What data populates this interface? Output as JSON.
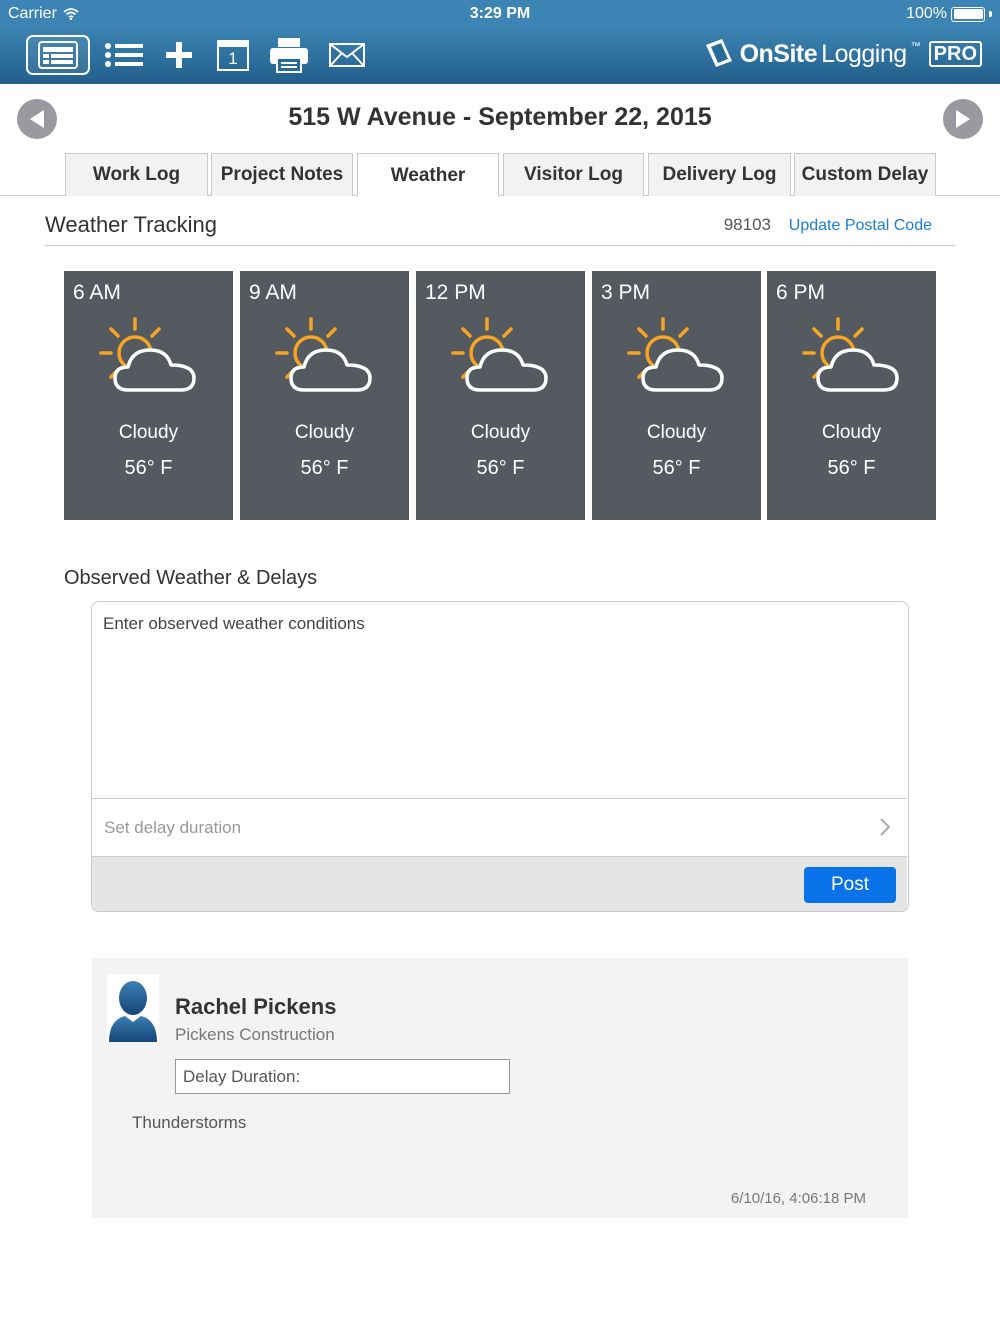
{
  "status": {
    "carrier": "Carrier",
    "time": "3:29 PM",
    "battery": "100%"
  },
  "toolbar": {
    "logo_onsite": "OnSite",
    "logo_logging": "Logging",
    "logo_tm": "™",
    "logo_pro": "PRO",
    "icons": [
      "daily-log-icon",
      "list-icon",
      "plus-icon",
      "calendar-icon",
      "printer-icon",
      "mail-icon"
    ],
    "calendar_day": "1"
  },
  "header": {
    "title": "515 W Avenue - September 22, 2015"
  },
  "tabs": [
    {
      "label": "Work Log"
    },
    {
      "label": "Project Notes"
    },
    {
      "label": "Weather"
    },
    {
      "label": "Visitor Log"
    },
    {
      "label": "Delivery Log"
    },
    {
      "label": "Custom Delay"
    }
  ],
  "active_tab": "Weather",
  "weather": {
    "title": "Weather Tracking",
    "postal_code": "98103",
    "update_link": "Update Postal Code",
    "forecast": [
      {
        "time": "6 AM",
        "condition": "Cloudy",
        "temp": "56° F"
      },
      {
        "time": "9 AM",
        "condition": "Cloudy",
        "temp": "56° F"
      },
      {
        "time": "12 PM",
        "condition": "Cloudy",
        "temp": "56° F"
      },
      {
        "time": "3 PM",
        "condition": "Cloudy",
        "temp": "56° F"
      },
      {
        "time": "6 PM",
        "condition": "Cloudy",
        "temp": "56° F"
      }
    ]
  },
  "observed": {
    "title": "Observed Weather & Delays",
    "placeholder": "Enter observed weather conditions",
    "value": "",
    "delay_label": "Set delay duration",
    "post_label": "Post"
  },
  "entry": {
    "name": "Rachel Pickens",
    "company": "Pickens Construction",
    "delay_label": "Delay Duration:",
    "note": "Thunderstorms",
    "timestamp": "6/10/16, 4:06:18 PM"
  },
  "colors": {
    "toolbar_top": "#3b84b3",
    "toolbar_bottom": "#235f8c",
    "forecast_bg": "#555a61",
    "sun": "#f5a623",
    "link": "#1a7fd4",
    "post_button": "#0a72e8"
  }
}
